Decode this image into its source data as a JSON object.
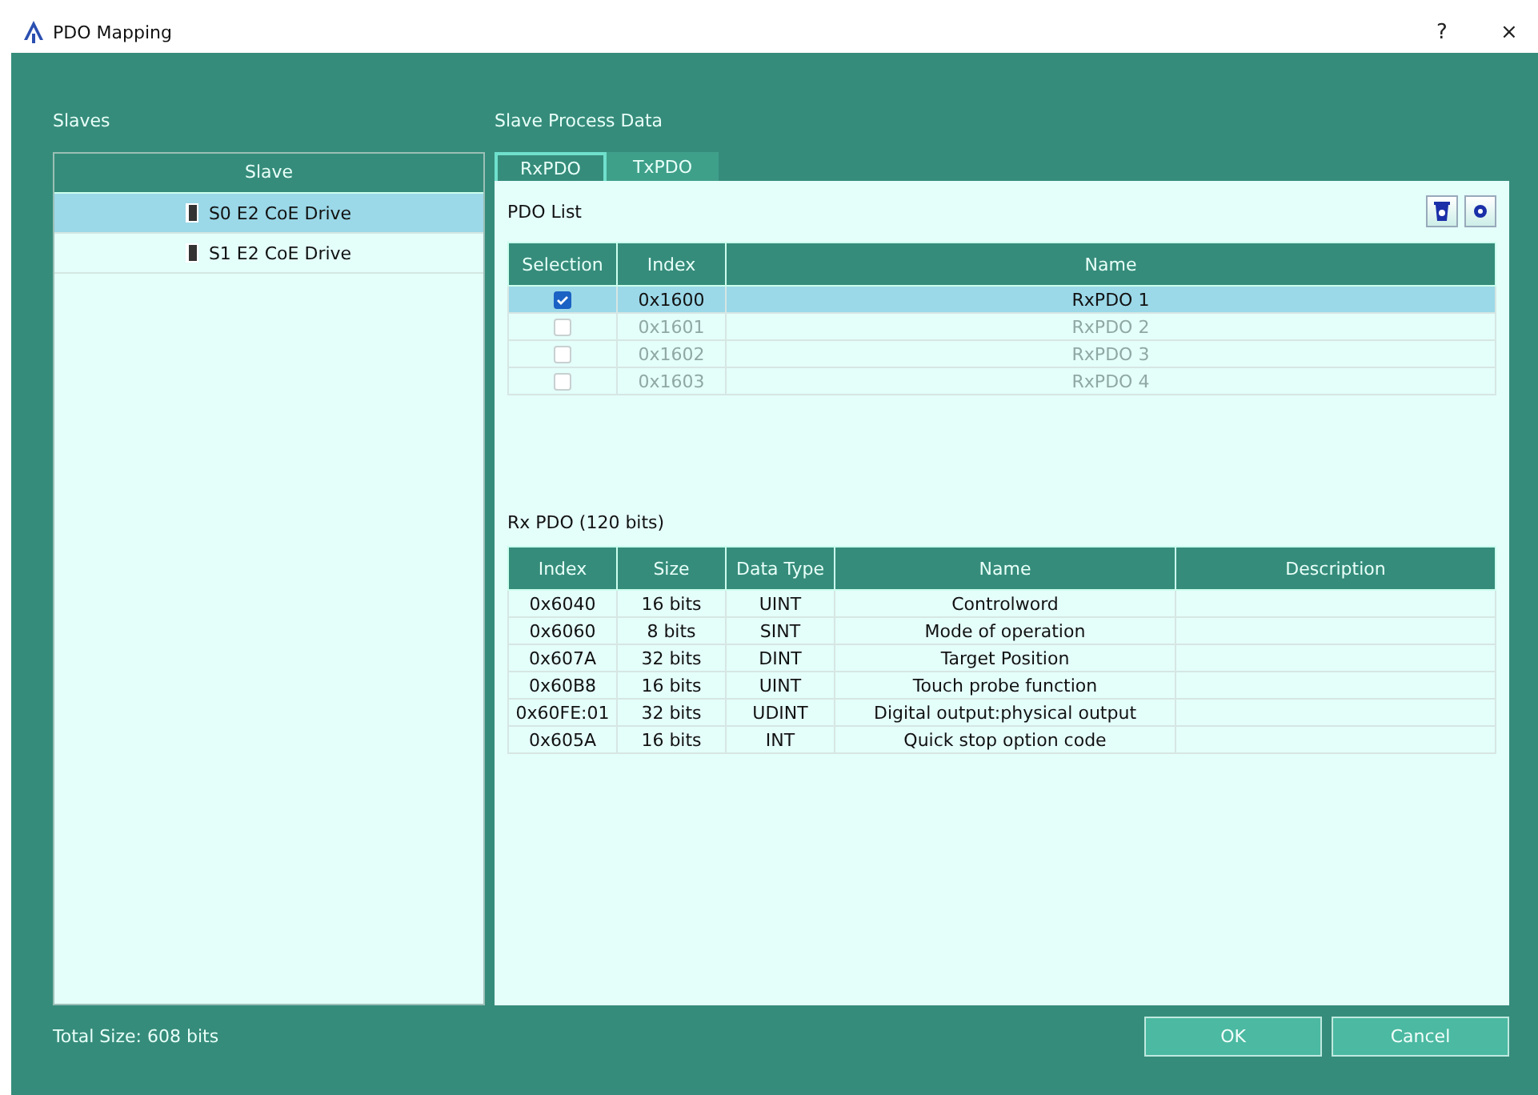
{
  "window": {
    "title": "PDO Mapping",
    "help": "?",
    "close": "×"
  },
  "slaves_label": "Slaves",
  "slaves": {
    "column": "Slave",
    "items": [
      {
        "name": "S0 E2 CoE Drive",
        "selected": true
      },
      {
        "name": "S1 E2 CoE Drive",
        "selected": false
      }
    ]
  },
  "process_label": "Slave Process Data",
  "tabs": [
    {
      "label": "RxPDO",
      "selected": true
    },
    {
      "label": "TxPDO",
      "selected": false
    }
  ],
  "pdo_list": {
    "title": "PDO List",
    "columns": [
      "Selection",
      "Index",
      "Name"
    ],
    "rows": [
      {
        "index": "0x1600",
        "name": "RxPDO 1",
        "checked": true,
        "selected": true,
        "disabled": false
      },
      {
        "index": "0x1601",
        "name": "RxPDO 2",
        "checked": false,
        "selected": false,
        "disabled": true
      },
      {
        "index": "0x1602",
        "name": "RxPDO 3",
        "checked": false,
        "selected": false,
        "disabled": true
      },
      {
        "index": "0x1603",
        "name": "RxPDO 4",
        "checked": false,
        "selected": false,
        "disabled": true
      }
    ]
  },
  "entries": {
    "title": "Rx PDO (120 bits)",
    "columns": [
      "Index",
      "Size",
      "Data Type",
      "Name",
      "Description"
    ],
    "rows": [
      [
        "0x6040",
        "16 bits",
        "UINT",
        "Controlword"
      ],
      [
        "0x6060",
        "8 bits",
        "SINT",
        "Mode of operation"
      ],
      [
        "0x607A",
        "32 bits",
        "DINT",
        "Target Position"
      ],
      [
        "0x60B8",
        "16 bits",
        "UINT",
        "Touch probe function"
      ],
      [
        "0x60FE:01",
        "32 bits",
        "UDINT",
        "Digital output:physical output"
      ],
      [
        "0x605A",
        "16 bits",
        "INT",
        "Quick stop option code"
      ]
    ]
  },
  "total_size": "Total Size: 608 bits",
  "buttons": [
    "OK",
    "Cancel"
  ]
}
